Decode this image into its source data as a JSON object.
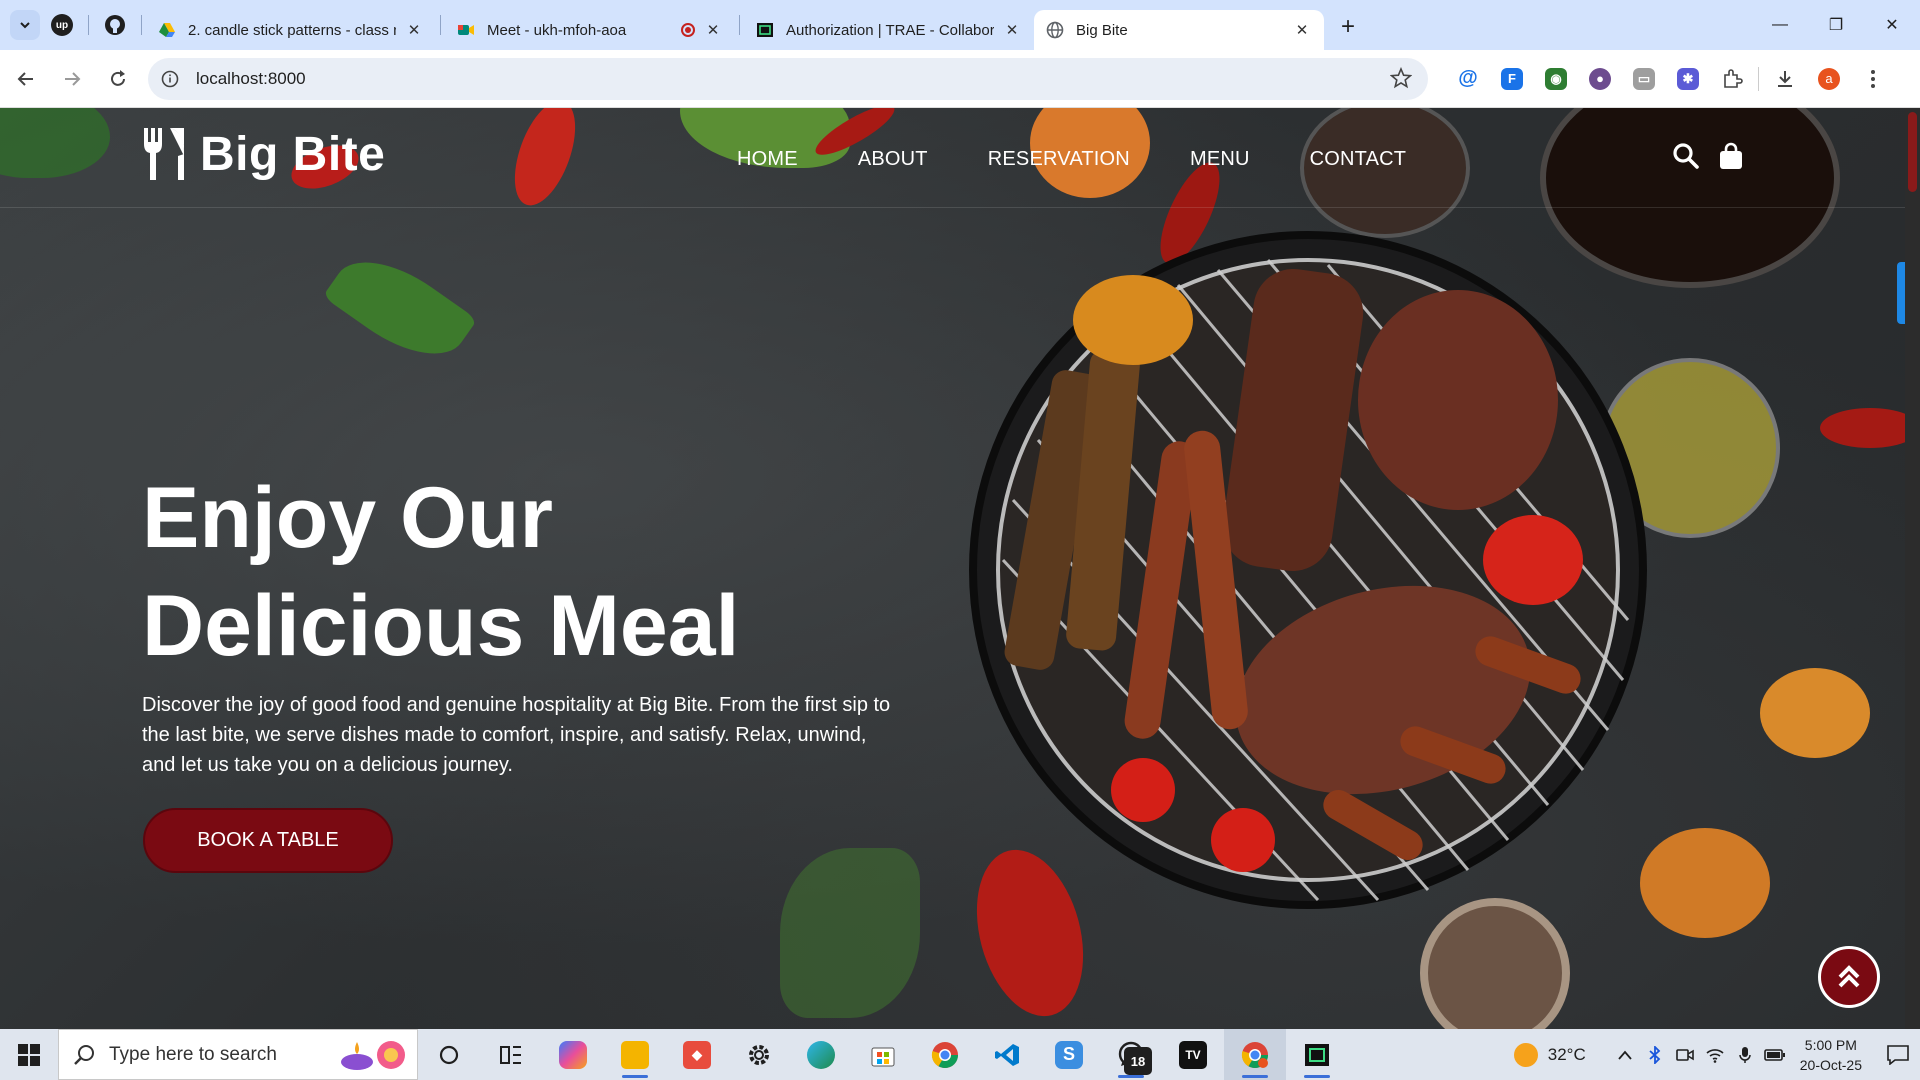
{
  "browser": {
    "tabs": [
      {
        "title": "2. candle stick patterns - class n",
        "close": "✕",
        "color": "#1e8e3e"
      },
      {
        "title": "Meet - ukh-mfoh-aoa",
        "close": "✕",
        "color": "#00897b"
      },
      {
        "title": "Authorization | TRAE - Collabor",
        "close": "✕",
        "color": "#111111"
      },
      {
        "title": "Big Bite",
        "close": "✕",
        "color": "#5f6368"
      }
    ],
    "new_tab": "+",
    "url": "localhost:8000",
    "window_controls": [
      "—",
      "❐",
      "✕"
    ]
  },
  "site": {
    "brand": "Big Bite",
    "nav": [
      "HOME",
      "ABOUT",
      "RESERVATION",
      "MENU",
      "CONTACT"
    ],
    "hero": {
      "title_line1": "Enjoy Our",
      "title_line2": "Delicious Meal",
      "text": "Discover the joy of good food and genuine hospitality at Big Bite. From the first sip to the last bite, we serve dishes made to comfort, inspire, and satisfy. Relax, unwind, and let us take you on a delicious journey.",
      "cta": "BOOK A TABLE"
    },
    "accent_color": "#7a0a12"
  },
  "taskbar": {
    "search_placeholder": "Type here to search",
    "whatsapp_badge": "18",
    "temperature": "32°C",
    "time": "5:00 PM",
    "date": "20-Oct-25"
  }
}
